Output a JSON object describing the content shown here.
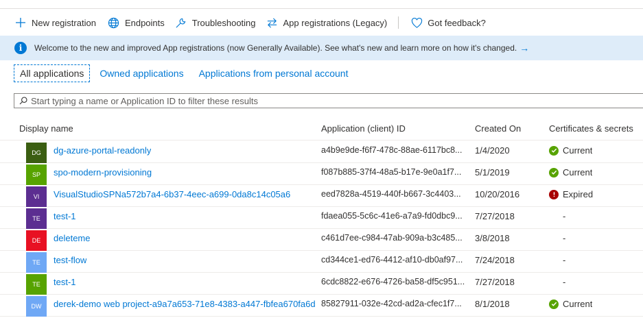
{
  "toolbar": {
    "new_registration": "New registration",
    "endpoints": "Endpoints",
    "troubleshooting": "Troubleshooting",
    "legacy": "App registrations (Legacy)",
    "feedback": "Got feedback?"
  },
  "banner": {
    "message": "Welcome to the new and improved App registrations (now Generally Available). See what's new and learn more on how it's changed.",
    "arrow": "→"
  },
  "tabs": {
    "all": "All applications",
    "owned": "Owned applications",
    "personal": "Applications from personal account"
  },
  "search": {
    "placeholder": "Start typing a name or Application ID to filter these results"
  },
  "table": {
    "headers": {
      "display_name": "Display name",
      "app_id": "Application (client) ID",
      "created_on": "Created On",
      "certs": "Certificates & secrets"
    },
    "rows": [
      {
        "initials": "DG",
        "color": "#3b5e11",
        "name": "dg-azure-portal-readonly",
        "app_id": "a4b9e9de-f6f7-478c-88ae-6117bc8...",
        "created": "1/4/2020",
        "cert": "Current",
        "status": "current"
      },
      {
        "initials": "SP",
        "color": "#57a300",
        "name": "spo-modern-provisioning",
        "app_id": "f087b885-37f4-48a5-b17e-9e0a1f7...",
        "created": "5/1/2019",
        "cert": "Current",
        "status": "current"
      },
      {
        "initials": "VI",
        "color": "#5c2e91",
        "name": "VisualStudioSPNa572b7a4-6b37-4eec-a699-0da8c14c05a6",
        "app_id": "eed7828a-4519-440f-b667-3c4403...",
        "created": "10/20/2016",
        "cert": "Expired",
        "status": "expired"
      },
      {
        "initials": "TE",
        "color": "#5c2e91",
        "name": "test-1",
        "app_id": "fdaea055-5c6c-41e6-a7a9-fd0dbc9...",
        "created": "7/27/2018",
        "cert": "-",
        "status": "none"
      },
      {
        "initials": "DE",
        "color": "#e81123",
        "name": "deleteme",
        "app_id": "c461d7ee-c984-47ab-909a-b3c485...",
        "created": "3/8/2018",
        "cert": "-",
        "status": "none"
      },
      {
        "initials": "TE",
        "color": "#6fa8f5",
        "name": "test-flow",
        "app_id": "cd344ce1-ed76-4412-af10-db0af97...",
        "created": "7/24/2018",
        "cert": "-",
        "status": "none"
      },
      {
        "initials": "TE",
        "color": "#57a300",
        "name": "test-1",
        "app_id": "6cdc8822-e676-4726-ba58-df5c951...",
        "created": "7/27/2018",
        "cert": "-",
        "status": "none"
      },
      {
        "initials": "DW",
        "color": "#6fa8f5",
        "name": "derek-demo web project-a9a7a653-71e8-4383-a447-fbfea670fa6d",
        "app_id": "85827911-032e-42cd-ad2a-cfec1f7...",
        "created": "8/1/2018",
        "cert": "Current",
        "status": "current"
      }
    ]
  },
  "colors": {
    "accent": "#0078d4",
    "current": "#57a300",
    "expired": "#a80000",
    "banner": "#deecf9"
  }
}
